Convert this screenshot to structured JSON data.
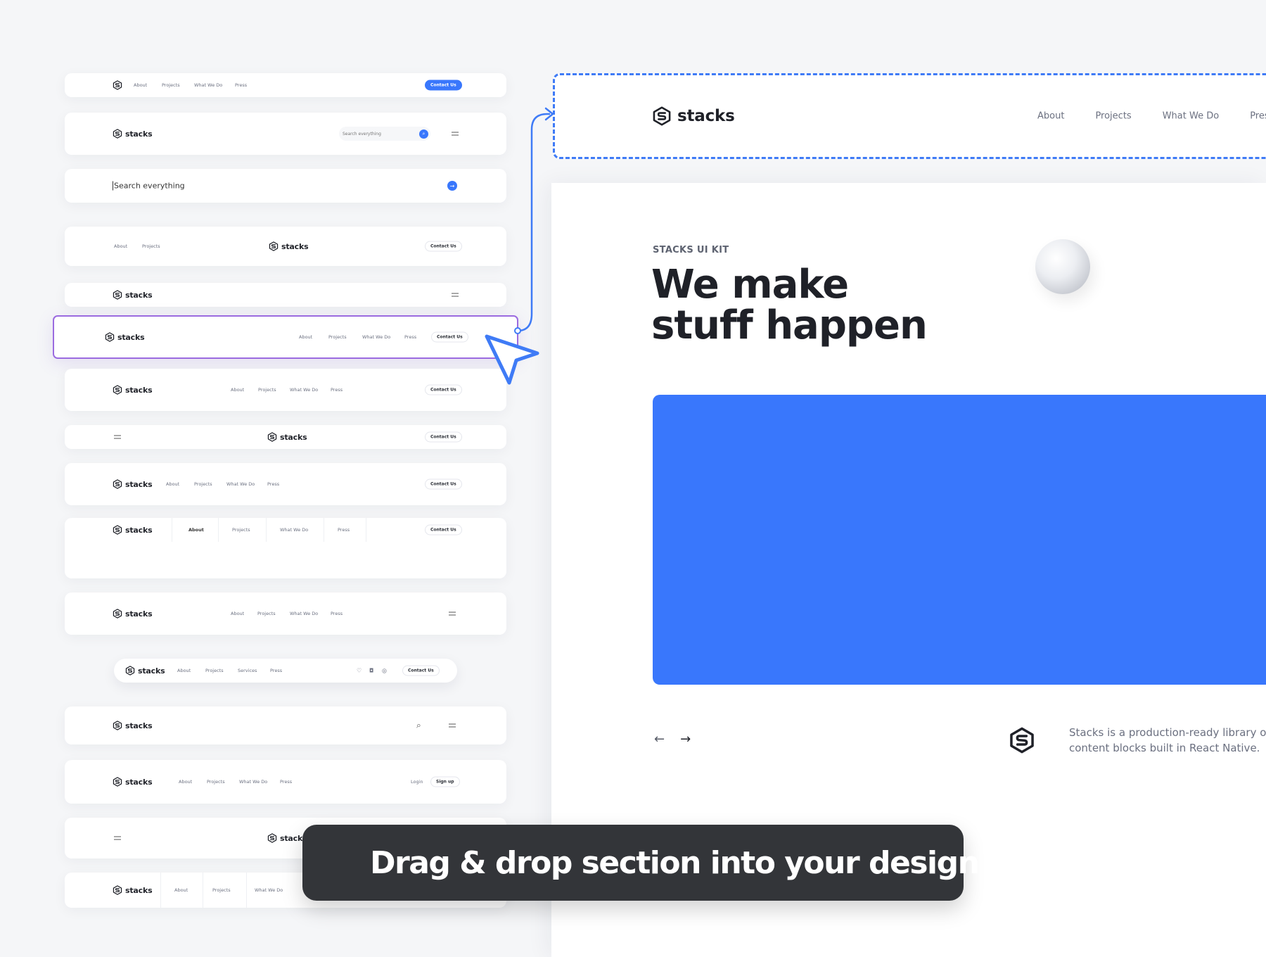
{
  "brand": "stacks",
  "variants": {
    "v1": {
      "links": [
        "About",
        "Projects",
        "What We Do",
        "Press"
      ],
      "cta": "Contact Us"
    },
    "v2": {
      "search_placeholder": "Search everything"
    },
    "v3": {
      "search_text": "Search everything"
    },
    "v4": {
      "links": [
        "About",
        "Projects"
      ],
      "cta": "Contact Us"
    },
    "v6_selected": {
      "links": [
        "About",
        "Projects",
        "What We Do",
        "Press"
      ],
      "cta": "Contact Us"
    },
    "v7": {
      "links": [
        "About",
        "Projects",
        "What We Do",
        "Press"
      ],
      "cta": "Contact Us"
    },
    "v8": {
      "cta": "Contact Us"
    },
    "v9": {
      "links": [
        "About",
        "Projects",
        "What We Do",
        "Press"
      ],
      "cta": "Contact Us"
    },
    "v10": {
      "links": [
        "About",
        "Projects",
        "What We Do",
        "Press"
      ],
      "cta": "Contact Us"
    },
    "v11": {
      "links": [
        "About",
        "Projects",
        "What We Do",
        "Press"
      ]
    },
    "v12": {
      "links": [
        "About",
        "Projects",
        "Services",
        "Press"
      ],
      "cta": "Contact Us"
    },
    "v14": {
      "links": [
        "About",
        "Projects",
        "What We Do",
        "Press"
      ],
      "login": "Login",
      "signup": "Sign up"
    },
    "v16": {
      "links": [
        "About",
        "Projects",
        "What We Do"
      ]
    }
  },
  "preview": {
    "nav_links": [
      "About",
      "Projects",
      "What We Do",
      "Press"
    ],
    "eyebrow": "STACKS UI KIT",
    "title_line1": "We make",
    "title_line2": "stuff happen",
    "prev_arrow": "←",
    "next_arrow": "→",
    "description_line1": "Stacks is a production-ready library of",
    "description_line2": "content blocks built in React Native."
  },
  "banner": {
    "text": "Drag & drop section into your design"
  },
  "colors": {
    "accent": "#3977fc",
    "selection": "#9b6be0",
    "banner_bg": "#333539",
    "pill_green": "#3dbd6a"
  }
}
